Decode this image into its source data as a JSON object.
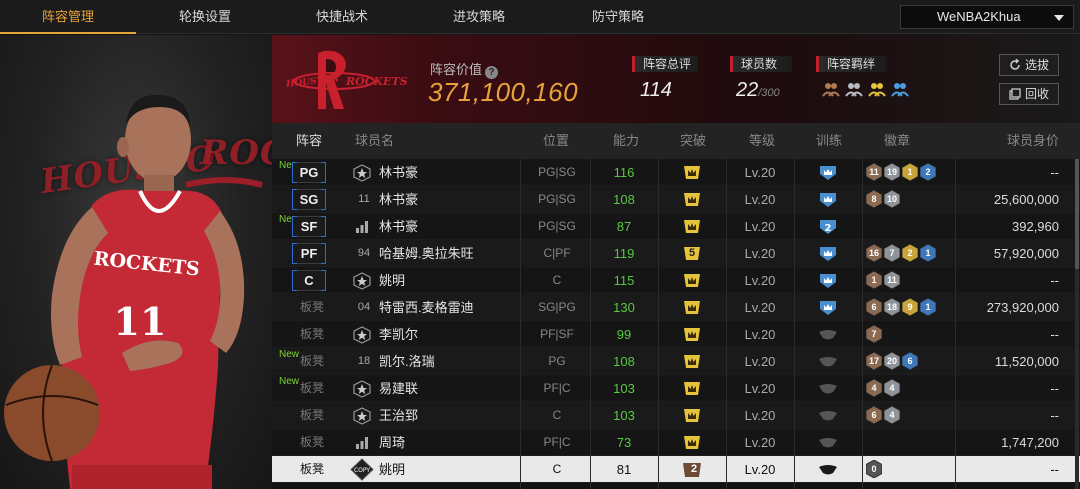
{
  "nav": {
    "tabs": [
      "阵容管理",
      "轮换设置",
      "快捷战术",
      "进攻策略",
      "防守策略"
    ],
    "active_tab": 0,
    "account": "WeNBA2Khua"
  },
  "player_art": {
    "jersey_text": "ROCKETS",
    "jersey_number": "11",
    "watermark_left": "HOUSTO",
    "watermark_right": "ROCK"
  },
  "team": {
    "logo_left_text": "HOUSTON",
    "logo_right_text": "ROCKETS",
    "value_label": "阵容价值",
    "value": "371,100,160",
    "overall_label": "阵容总评",
    "overall": "114",
    "count_label": "球员数",
    "count": "22",
    "count_max": "/300",
    "chemistry_label": "阵容羁绊",
    "buttons": [
      "选拔",
      "回收"
    ]
  },
  "table": {
    "headers": [
      "阵容",
      "球员名",
      "位置",
      "能力",
      "突破",
      "等级",
      "训练",
      "徽章",
      "球员身价"
    ],
    "rows": [
      {
        "is_new": true,
        "slot": "PG",
        "starter": true,
        "icon": "star",
        "name": "林书豪",
        "positions": "PG|SG",
        "ability": "116",
        "breakthrough": "",
        "level": "Lv.20",
        "training": "blue",
        "badges": [
          "11",
          "19",
          "1",
          "2"
        ],
        "badge_colors": [
          "bronze",
          "silver",
          "gold",
          "blue"
        ],
        "value": "--"
      },
      {
        "is_new": false,
        "slot": "SG",
        "starter": true,
        "icon": "11",
        "name": "林书豪",
        "positions": "PG|SG",
        "ability": "108",
        "breakthrough": "",
        "level": "Lv.20",
        "training": "blue",
        "badges": [
          "8",
          "10"
        ],
        "badge_colors": [
          "bronze",
          "silver"
        ],
        "value": "25,600,000"
      },
      {
        "is_new": true,
        "slot": "SF",
        "starter": true,
        "icon": "bars",
        "name": "林书豪",
        "positions": "PG|SG",
        "ability": "87",
        "breakthrough": "",
        "level": "Lv.20",
        "training": "blue2",
        "badges": [],
        "badge_colors": [],
        "value": "392,960"
      },
      {
        "is_new": false,
        "slot": "PF",
        "starter": true,
        "icon": "94",
        "name": "哈基姆.奥拉朱旺",
        "positions": "C|PF",
        "ability": "119",
        "breakthrough": "5",
        "level": "Lv.20",
        "training": "blue",
        "badges": [
          "16",
          "7",
          "2",
          "1"
        ],
        "badge_colors": [
          "bronze",
          "silver",
          "gold",
          "blue"
        ],
        "value": "57,920,000"
      },
      {
        "is_new": false,
        "slot": "C",
        "starter": true,
        "icon": "star",
        "name": "姚明",
        "positions": "C",
        "ability": "115",
        "breakthrough": "",
        "level": "Lv.20",
        "training": "blue",
        "badges": [
          "1",
          "11"
        ],
        "badge_colors": [
          "bronze",
          "silver"
        ],
        "value": "--"
      },
      {
        "is_new": false,
        "slot": "板凳",
        "starter": false,
        "icon": "04",
        "name": "特雷西.麦格雷迪",
        "positions": "SG|PG",
        "ability": "130",
        "breakthrough": "",
        "level": "Lv.20",
        "training": "blue",
        "badges": [
          "6",
          "18",
          "9",
          "1"
        ],
        "badge_colors": [
          "bronze",
          "silver",
          "gold",
          "blue"
        ],
        "value": "273,920,000"
      },
      {
        "is_new": false,
        "slot": "板凳",
        "starter": false,
        "icon": "star",
        "name": "李凯尔",
        "positions": "PF|SF",
        "ability": "99",
        "breakthrough": "",
        "level": "Lv.20",
        "training": "gray",
        "badges": [
          "7"
        ],
        "badge_colors": [
          "bronze"
        ],
        "value": "--"
      },
      {
        "is_new": true,
        "slot": "板凳",
        "starter": false,
        "icon": "18",
        "name": "凯尔.洛瑞",
        "positions": "PG",
        "ability": "108",
        "breakthrough": "",
        "level": "Lv.20",
        "training": "gray",
        "badges": [
          "17",
          "20",
          "6"
        ],
        "badge_colors": [
          "bronze",
          "silver",
          "blue"
        ],
        "value": "11,520,000"
      },
      {
        "is_new": true,
        "slot": "板凳",
        "starter": false,
        "icon": "star",
        "name": "易建联",
        "positions": "PF|C",
        "ability": "103",
        "breakthrough": "",
        "level": "Lv.20",
        "training": "gray",
        "badges": [
          "4",
          "4"
        ],
        "badge_colors": [
          "bronze",
          "silver"
        ],
        "value": "--"
      },
      {
        "is_new": false,
        "slot": "板凳",
        "starter": false,
        "icon": "star",
        "name": "王治郅",
        "positions": "C",
        "ability": "103",
        "breakthrough": "",
        "level": "Lv.20",
        "training": "gray",
        "badges": [
          "6",
          "4"
        ],
        "badge_colors": [
          "bronze",
          "silver"
        ],
        "value": "--"
      },
      {
        "is_new": false,
        "slot": "板凳",
        "starter": false,
        "icon": "bars",
        "name": "周琦",
        "positions": "PF|C",
        "ability": "73",
        "breakthrough": "",
        "level": "Lv.20",
        "training": "gray",
        "badges": [],
        "badge_colors": [],
        "value": "1,747,200"
      },
      {
        "is_new": false,
        "slot": "板凳",
        "starter": false,
        "icon": "copy",
        "name": "姚明",
        "positions": "C",
        "ability": "81",
        "breakthrough": "2",
        "level": "Lv.20",
        "training": "dark",
        "badges": [
          "0"
        ],
        "badge_colors": [
          "gray"
        ],
        "value": "--",
        "selected": true
      }
    ]
  },
  "colors": {
    "accent": "#e8a23a",
    "green": "#58c842",
    "red": "#c0202b",
    "blue_training": "#4a8fcf"
  }
}
